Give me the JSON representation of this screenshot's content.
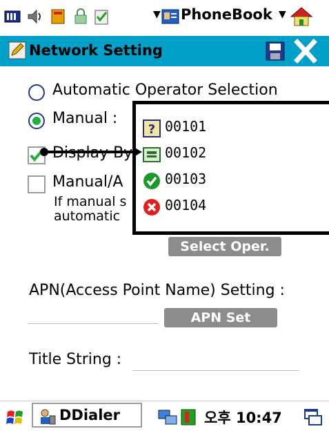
{
  "status_bar": {
    "app_title": "PhoneBook"
  },
  "title_bar": {
    "title": "Network Setting"
  },
  "operator": {
    "automatic_label": "Automatic Operator Selection",
    "manual_label": "Manual :",
    "selected": "manual"
  },
  "display_label_visible": "Display By",
  "manual_auto": {
    "label_visible": "Manual/A",
    "line2_visible": "If manual s",
    "line3_visible": "automatic"
  },
  "select_operator_button": "Select Oper.",
  "apn": {
    "label": "APN(Access Point Name) Setting :",
    "value": "",
    "button": "APN Set"
  },
  "title_string": {
    "label": "Title String :",
    "value": ""
  },
  "operator_list": [
    {
      "code": "00101",
      "icon": "question-icon"
    },
    {
      "code": "00102",
      "icon": "sim-card-icon"
    },
    {
      "code": "00103",
      "icon": "check-icon"
    },
    {
      "code": "00104",
      "icon": "x-icon"
    }
  ],
  "taskbar": {
    "task_label": "DDialer",
    "clock": "오후 10:47"
  },
  "colors": {
    "title_bar": "#00a0c8",
    "button": "#8c8c8c"
  }
}
